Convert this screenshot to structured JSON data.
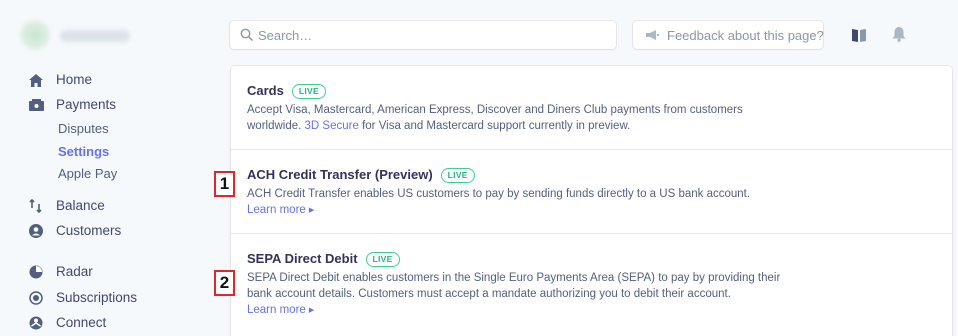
{
  "header": {
    "search_placeholder": "Search…",
    "feedback_label": "Feedback about this page?"
  },
  "sidebar": {
    "items": [
      {
        "label": "Home",
        "icon": "home-icon"
      },
      {
        "label": "Payments",
        "icon": "payments-icon"
      },
      {
        "label": "Disputes"
      },
      {
        "label": "Settings",
        "active": true
      },
      {
        "label": "Apple Pay"
      },
      {
        "label": "Balance",
        "icon": "balance-icon"
      },
      {
        "label": "Customers",
        "icon": "customers-icon"
      },
      {
        "label": "Radar",
        "icon": "radar-icon"
      },
      {
        "label": "Subscriptions",
        "icon": "subscriptions-icon"
      },
      {
        "label": "Connect",
        "icon": "connect-icon"
      }
    ]
  },
  "methods": [
    {
      "title": "Cards",
      "badge": "LIVE",
      "desc_1": "Accept Visa, Mastercard, American Express, Discover and Diners Club payments from customers",
      "desc_2a": "worldwide.",
      "desc_link": "3D Secure",
      "desc_2b": "for Visa and Mastercard support currently in preview."
    },
    {
      "title": "ACH Credit Transfer (Preview)",
      "badge": "LIVE",
      "desc_1": "ACH Credit Transfer enables US customers to pay by sending funds directly to a US bank account.",
      "learn_more": "Learn more",
      "callout": "1"
    },
    {
      "title": "SEPA Direct Debit",
      "badge": "LIVE",
      "desc_1": "SEPA Direct Debit enables customers in the Single Euro Payments Area (SEPA) to pay by providing their",
      "desc_2": "bank account details. Customers must accept a mandate authorizing you to debit their account.",
      "learn_more": "Learn more",
      "callout": "2"
    }
  ],
  "colors": {
    "accent": "#6772e5",
    "live_badge": "#24b47e",
    "callout_border": "#e0262d"
  }
}
